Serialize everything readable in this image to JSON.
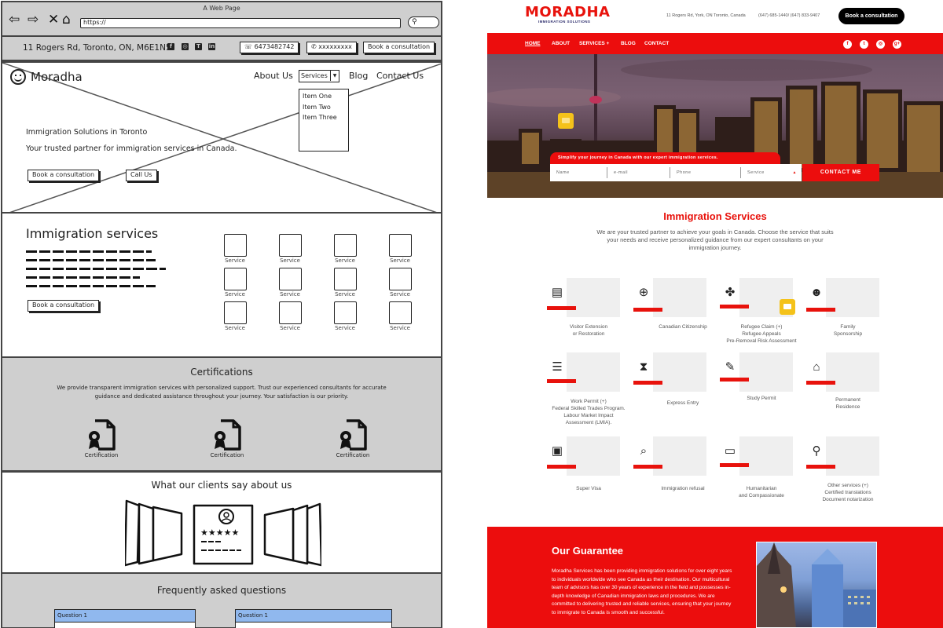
{
  "wireframe": {
    "window_title": "A Web Page",
    "url": "https://",
    "topbar": {
      "address": "11 Rogers Rd, Toronto, ON, M6E1N5",
      "social_icons": [
        "facebook-icon",
        "instagram-icon",
        "teams-icon",
        "linkedin-icon"
      ],
      "phone": "6473482742",
      "whatsapp": "xxxxxxxxx",
      "book_label": "Book a consultation"
    },
    "header": {
      "logo_text": "Moradha",
      "nav": [
        "About Us",
        "Services",
        "Blog",
        "Contact Us"
      ],
      "dropdown_items": [
        "Item One",
        "Item Two",
        "Item Three"
      ]
    },
    "hero": {
      "title": "Immigration Solutions in Toronto",
      "subtitle": "Your trusted partner for immigration services in Canada.",
      "book_label": "Book a consultation",
      "call_label": "Call Us"
    },
    "services": {
      "heading": "Immigration services",
      "book_label": "Book a consultation",
      "items": [
        "Service",
        "Service",
        "Service",
        "Service",
        "Service",
        "Service",
        "Service",
        "Service",
        "Service",
        "Service",
        "Service",
        "Service"
      ]
    },
    "certifications": {
      "heading": "Certifications",
      "text": "We provide transparent immigration services with personalized support. Trust our experienced consultants for accurate guidance and dedicated assistance throughout your journey. Your satisfaction is our priority.",
      "items": [
        "Certification",
        "Certification",
        "Certification"
      ]
    },
    "testimonials": {
      "heading": "What our clients say about us",
      "rating": 5
    },
    "faq": {
      "heading": "Frequently asked questions",
      "questions": [
        "Question 1",
        "Question 1"
      ]
    }
  },
  "design": {
    "brand": {
      "name": "MORADHA",
      "tagline": "IMMIGRATION SOLUTIONS",
      "accent": "#ec0d0d"
    },
    "header": {
      "address": "11 Rogers Rd, York, ON Toronto, Canada",
      "phones": "(647) 685-1440/ (647) 833-9407",
      "book_label": "Book a consultation"
    },
    "nav": {
      "items": [
        "HOME",
        "ABOUT",
        "SERVICES +",
        "BLOG",
        "CONTACT"
      ],
      "active": "HOME",
      "social_icons": [
        "facebook-icon",
        "twitter-icon",
        "instagram-icon",
        "google-plus-icon"
      ]
    },
    "hero": {
      "tagline": "Simplify your journey in Canada with our expert immigration services.",
      "form": {
        "name_placeholder": "Name",
        "email_placeholder": "e-mail",
        "phone_placeholder": "Phone",
        "service_placeholder": "Service"
      },
      "contact_label": "CONTACT ME"
    },
    "services": {
      "heading": "Immigration Services",
      "intro": "We are your trusted partner to achieve your goals in Canada. Choose the service that suits your needs and receive personalized guidance from our expert consultants on your immigration journey.",
      "cards": [
        {
          "icon": "passport-book-icon",
          "label": "Visitor Extension\nor Restoration"
        },
        {
          "icon": "passport-globe-icon",
          "label": "Canadian Citizenship"
        },
        {
          "icon": "handshake-icon",
          "label": "Refugee Claim (+)\nRefugee Appeals\nPre-Removal Risk Assessment"
        },
        {
          "icon": "family-icon",
          "label": "Family\nSponsorship"
        },
        {
          "icon": "id-badge-icon",
          "label": "Work Permit (+)\nFederal Skilled Trades Program.\nLabour Market Impact\nAssessment (LMIA)."
        },
        {
          "icon": "hourglass-icon",
          "label": "Express Entry"
        },
        {
          "icon": "study-scroll-icon",
          "label": "Study Permit"
        },
        {
          "icon": "house-icon",
          "label": "Permanent\nResidence"
        },
        {
          "icon": "certificate-icon",
          "label": "Super Visa"
        },
        {
          "icon": "document-search-icon",
          "label": "Immigration refusal"
        },
        {
          "icon": "briefcase-icon",
          "label": "Humanitarian\nand Compassionate"
        },
        {
          "icon": "magnifier-icon",
          "label": "Other services (+)\nCertified translations\nDocument notarization"
        }
      ]
    },
    "guarantee": {
      "heading": "Our Guarantee",
      "text": "Moradha Services has been providing immigration solutions for over eight years to individuals worldwide who see Canada as their destination. Our multicultural team of advisors has over 30 years of experience in the field and possesses in-depth knowledge of Canadian immigration laws and procedures. We are committed to delivering trusted and reliable services, ensuring that your journey to immigrate to Canada is smooth and successful."
    }
  }
}
